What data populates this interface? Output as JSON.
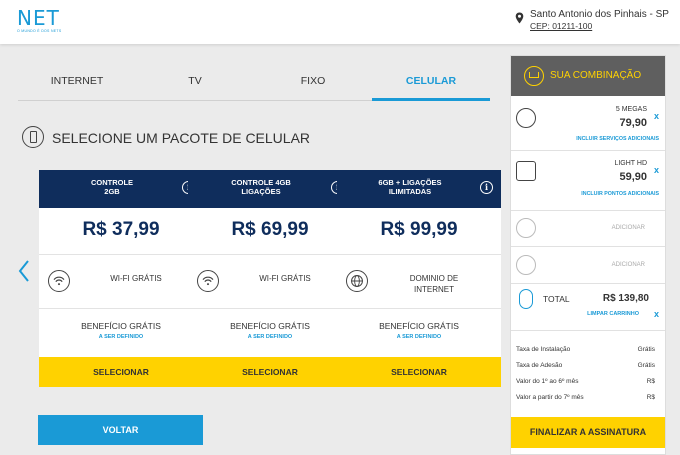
{
  "header": {
    "logo": "NET",
    "logo_tagline": "O MUNDO É DOS NETS",
    "location_city": "Santo Antonio dos Pinhais - SP",
    "location_cep": "CEP: 01211-100"
  },
  "tabs": [
    {
      "label": "INTERNET",
      "active": false
    },
    {
      "label": "TV",
      "active": false
    },
    {
      "label": "FIXO",
      "active": false
    },
    {
      "label": "CELULAR",
      "active": true
    }
  ],
  "section_title": "SELECIONE UM PACOTE DE CELULAR",
  "plans": [
    {
      "name": "CONTROLE\n2GB",
      "price": "R$ 37,99",
      "feature": "WI-FI GRÁTIS",
      "feature_icon": "wifi-icon",
      "benefit": "BENEFÍCIO GRÁTIS",
      "benefit_sub": "A SER DEFINIDO",
      "button": "SELECIONAR"
    },
    {
      "name": "CONTROLE 4GB\nLIGAÇÕES",
      "price": "R$ 69,99",
      "feature": "WI-FI GRÁTIS",
      "feature_icon": "wifi-icon",
      "benefit": "BENEFÍCIO GRÁTIS",
      "benefit_sub": "A SER DEFINIDO",
      "button": "SELECIONAR"
    },
    {
      "name": "6GB + LIGAÇÕES\nILIMITADAS",
      "price": "R$ 99,99",
      "feature": "DOMINIO DE\nINTERNET",
      "feature_icon": "globe-icon",
      "benefit": "BENEFÍCIO GRÁTIS",
      "benefit_sub": "A SER DEFINIDO",
      "button": "SELECIONAR"
    }
  ],
  "back_button": "VOLTAR",
  "cart": {
    "title": "SUA COMBINAÇÃO",
    "items": [
      {
        "name": "5 MEGAS",
        "price": "79,90",
        "link": "INCLUIR SERVIÇOS ADICIONAIS"
      },
      {
        "name": "LIGHT HD",
        "price": "59,90",
        "link": "INCLUIR PONTOS ADICIONAIS"
      }
    ],
    "add_labels": [
      "ADICIONAR",
      "ADICIONAR"
    ],
    "total_label": "TOTAL",
    "total_value": "R$ 139,80",
    "clear_label": "LIMPAR CARRINHO",
    "fees": [
      {
        "label": "Taxa de Instalação",
        "value": "Grátis"
      },
      {
        "label": "Taxa de Adesão",
        "value": "Grátis"
      },
      {
        "label": "Valor do 1º ao 6º mês",
        "value": "R$"
      },
      {
        "label": "Valor a partir do 7º mês",
        "value": "R$"
      }
    ],
    "finish_button": "FINALIZAR A ASSINATURA"
  },
  "colors": {
    "brand_blue": "#1a9ad6",
    "navy": "#0f2d5c",
    "yellow": "#ffd200",
    "panel_head": "#5f5f5f"
  }
}
